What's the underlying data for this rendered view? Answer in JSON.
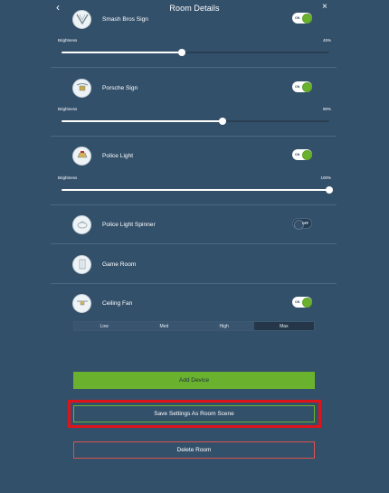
{
  "header": {
    "title": "Room Details",
    "back_glyph": "‹",
    "close_glyph": "×"
  },
  "devices": [
    {
      "name": "Smash Bros Sign",
      "icon": "sign-icon",
      "toggle": "ON",
      "brightness_label": "Brightness",
      "brightness_value": "45%",
      "brightness": 0.45
    },
    {
      "name": "Porsche Sign",
      "icon": "sign-icon",
      "toggle": "ON",
      "brightness_label": "Brightness",
      "brightness_value": "90%",
      "brightness": 0.6
    },
    {
      "name": "Police Light",
      "icon": "light-icon",
      "toggle": "ON",
      "brightness_label": "Brightness",
      "brightness_value": "100%",
      "brightness": 1.0
    },
    {
      "name": "Police Light Spinner",
      "icon": "spinner-icon",
      "toggle": "OFF"
    },
    {
      "name": "Game Room",
      "icon": "room-icon"
    },
    {
      "name": "Ceiling Fan",
      "icon": "fan-icon",
      "toggle": "ON"
    }
  ],
  "fan_speeds": [
    "Low",
    "Med",
    "High",
    "Max"
  ],
  "fan_speed_selected": "Max",
  "buttons": {
    "add_device": "Add Device",
    "save_scene": "Save Settings As Room Scene",
    "delete_room": "Delete Room"
  },
  "colors": {
    "background": "#33506b",
    "accent_green": "#6ab22e",
    "danger_red": "#d9534f",
    "highlight_red": "#e0131b"
  }
}
